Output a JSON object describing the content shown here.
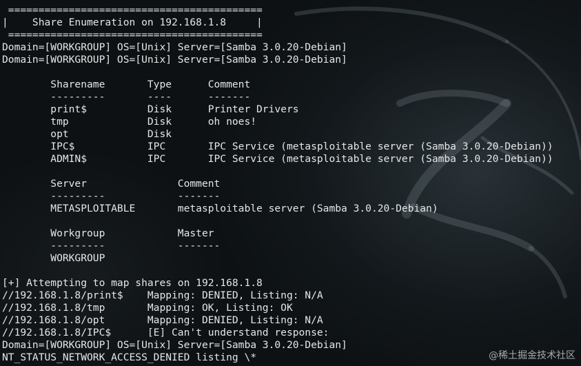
{
  "terminal": {
    "background_color": "#0d1113",
    "text_color": "#e6e6e6",
    "lines": [
      " ==========================================",
      "|    Share Enumeration on 192.168.1.8     |",
      " ==========================================",
      "Domain=[WORKGROUP] OS=[Unix] Server=[Samba 3.0.20-Debian]",
      "Domain=[WORKGROUP] OS=[Unix] Server=[Samba 3.0.20-Debian]",
      "",
      "        Sharename       Type      Comment",
      "        ---------       ----      -------",
      "        print$          Disk      Printer Drivers",
      "        tmp             Disk      oh noes!",
      "        opt             Disk",
      "        IPC$            IPC       IPC Service (metasploitable server (Samba 3.0.20-Debian))",
      "        ADMIN$          IPC       IPC Service (metasploitable server (Samba 3.0.20-Debian))",
      "",
      "        Server               Comment",
      "        ---------            -------",
      "        METASPLOITABLE       metasploitable server (Samba 3.0.20-Debian)",
      "",
      "        Workgroup            Master",
      "        ---------            -------",
      "        WORKGROUP",
      "",
      "[+] Attempting to map shares on 192.168.1.8",
      "//192.168.1.8/print$    Mapping: DENIED, Listing: N/A",
      "//192.168.1.8/tmp       Mapping: OK, Listing: OK",
      "//192.168.1.8/opt       Mapping: DENIED, Listing: N/A",
      "//192.168.1.8/IPC$      [E] Can't understand response:",
      "Domain=[WORKGROUP] OS=[Unix] Server=[Samba 3.0.20-Debian]",
      "NT_STATUS_NETWORK_ACCESS_DENIED listing \\*"
    ]
  },
  "watermark": "@稀土掘金技术社区"
}
